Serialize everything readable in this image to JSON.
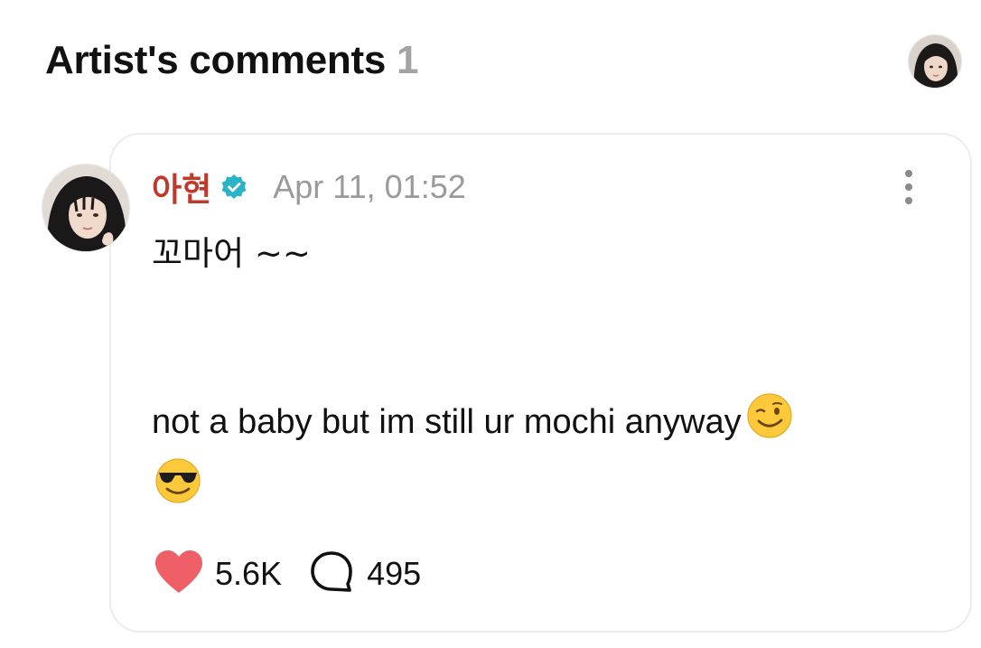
{
  "header": {
    "title": "Artist's comments",
    "count": "1"
  },
  "comment": {
    "author": "아현",
    "verified_icon": "verified-badge-icon",
    "timestamp": "Apr 11, 01:52",
    "line1": "꼬마어 ~~",
    "line2": "not a baby but im still ur mochi anyway",
    "emojis": [
      "winking-face-emoji",
      "smiling-face-with-sunglasses-emoji"
    ],
    "likes": "5.6K",
    "replies": "495"
  },
  "colors": {
    "author_name": "#c0392b",
    "verified": "#2bb3c8",
    "heart": "#ef5f67",
    "muted": "#9a9a9a"
  },
  "icons": {
    "more": "more-vertical-icon",
    "like": "heart-icon",
    "comment": "speech-bubble-icon"
  }
}
